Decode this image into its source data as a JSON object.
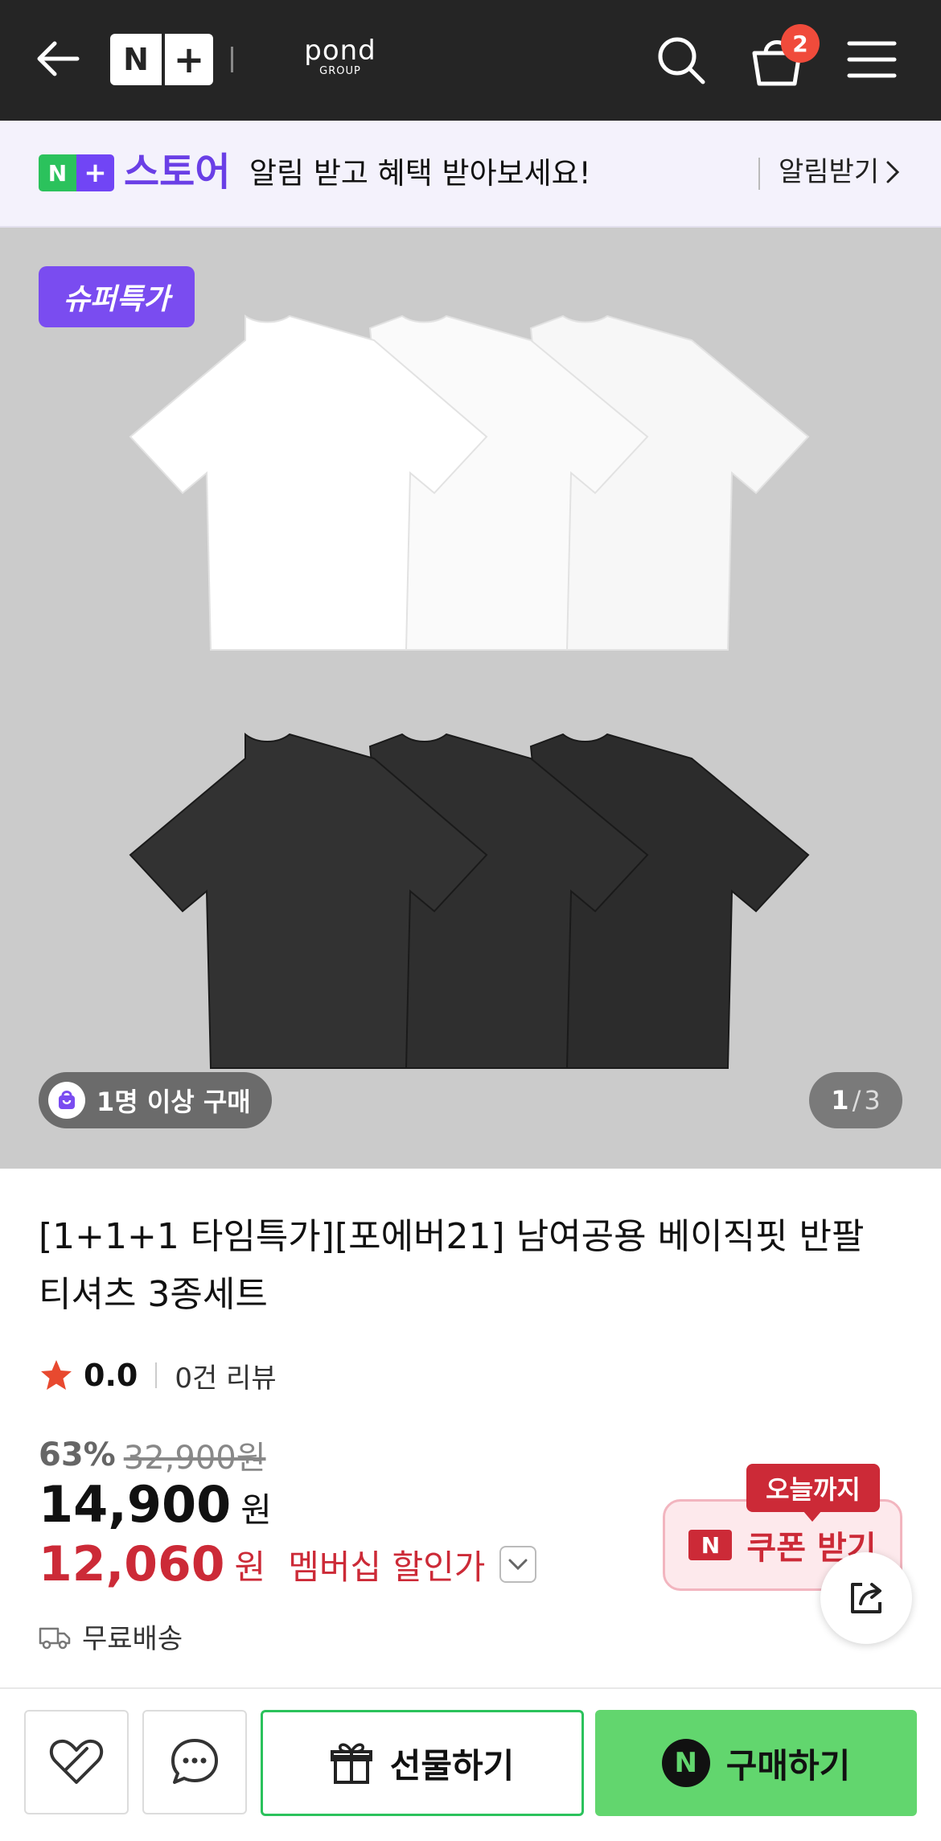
{
  "header": {
    "logo_n": "N",
    "logo_plus": "+",
    "brand_word": "pond",
    "brand_sub": "GROUP",
    "cart_count": "2"
  },
  "notice": {
    "badge_n": "N",
    "badge_plus": "+",
    "store": "스토어",
    "message": "알림 받고 혜택 받아보세요!",
    "action": "알림받기"
  },
  "gallery": {
    "badge": "슈퍼특가",
    "buyers": "1명 이상 구매",
    "current": "1",
    "separator": "/",
    "total": "3"
  },
  "product": {
    "title": "[1+1+1 타임특가][포에버21] 남여공용 베이직핏 반팔 티셔츠 3종세트",
    "rating": "0.0",
    "reviews": "0건 리뷰",
    "discount": "63%",
    "original_price": "32,900원",
    "price": "14,900",
    "price_unit": "원",
    "member_price": "12,060",
    "member_unit": "원",
    "member_label": "멤버십 할인가",
    "shipping": "무료배송"
  },
  "coupon": {
    "tag": "오늘까지",
    "label": "쿠폰 받기",
    "logo": "N"
  },
  "actions": {
    "gift": "선물하기",
    "buy": "구매하기",
    "buy_logo": "N"
  },
  "colors": {
    "header_bg": "#252525",
    "accent_purple": "#7a4cf0",
    "naver_green": "#62d66e",
    "sale_red": "#cc2a37"
  }
}
